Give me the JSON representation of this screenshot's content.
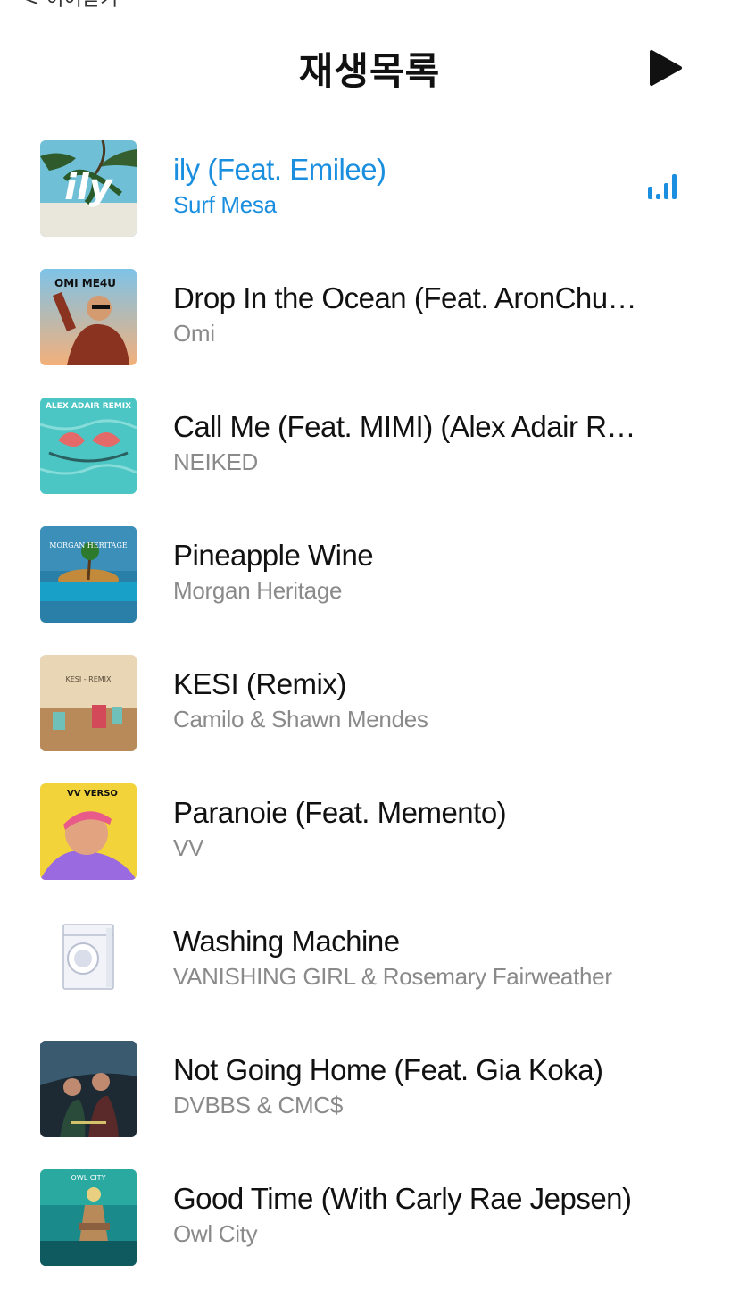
{
  "nav": {
    "back_label": "< 이어듣기"
  },
  "header": {
    "title": "재생목록"
  },
  "colors": {
    "accent": "#1a8fe0",
    "secondary_text": "#8a8a8a"
  },
  "tracks": [
    {
      "title": "ily (Feat. Emilee)",
      "artist": "Surf Mesa",
      "art_text": "ily",
      "playing": true
    },
    {
      "title": "Drop In the Ocean (Feat. AronChupa)",
      "artist": "Omi",
      "art_text": "OMI ME4U"
    },
    {
      "title": "Call Me (Feat. MIMI) (Alex Adair Remix)",
      "artist": "NEIKED",
      "art_text": "ALEX ADAIR REMIX"
    },
    {
      "title": "Pineapple Wine",
      "artist": "Morgan Heritage",
      "art_text": "MORGAN HERITAGE"
    },
    {
      "title": "KESI (Remix)",
      "artist": "Camilo & Shawn Mendes",
      "art_text": "KESI - REMIX"
    },
    {
      "title": "Paranoie (Feat. Memento)",
      "artist": "VV",
      "art_text": "VV VERSO"
    },
    {
      "title": "Washing Machine",
      "artist": "VANISHING GIRL & Rosemary Fairweather",
      "art_text": ""
    },
    {
      "title": "Not Going Home (Feat. Gia Koka)",
      "artist": "DVBBS & CMC$",
      "art_text": ""
    },
    {
      "title": "Good Time (With Carly Rae Jepsen)",
      "artist": "Owl City",
      "art_text": "OWL CITY"
    }
  ]
}
